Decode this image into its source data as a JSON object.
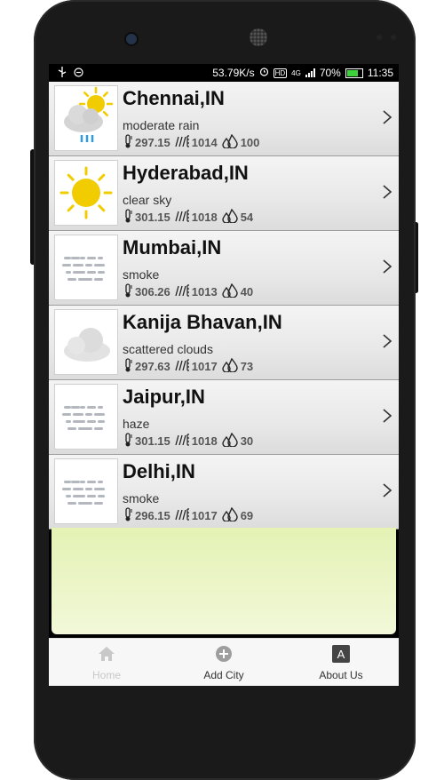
{
  "status_bar": {
    "net_speed": "53.79K/s",
    "network_type": "4G",
    "battery": "70%",
    "time": "11:35"
  },
  "cities": [
    {
      "name": "Chennai,IN",
      "desc": "moderate rain",
      "temp": "297.15",
      "pressure": "1014",
      "humidity": "100",
      "icon": "rain-cloud-icon"
    },
    {
      "name": "Hyderabad,IN",
      "desc": "clear sky",
      "temp": "301.15",
      "pressure": "1018",
      "humidity": "54",
      "icon": "sun-icon"
    },
    {
      "name": "Mumbai,IN",
      "desc": "smoke",
      "temp": "306.26",
      "pressure": "1013",
      "humidity": "40",
      "icon": "haze-icon"
    },
    {
      "name": "Kanija Bhavan,IN",
      "desc": "scattered clouds",
      "temp": "297.63",
      "pressure": "1017",
      "humidity": "73",
      "icon": "cloud-icon"
    },
    {
      "name": "Jaipur,IN",
      "desc": "haze",
      "temp": "301.15",
      "pressure": "1018",
      "humidity": "30",
      "icon": "haze-icon"
    },
    {
      "name": "Delhi,IN",
      "desc": "smoke",
      "temp": "296.15",
      "pressure": "1017",
      "humidity": "69",
      "icon": "haze-icon"
    }
  ],
  "tabs": [
    {
      "label": "Home",
      "icon": "home-icon",
      "active": false
    },
    {
      "label": "Add City",
      "icon": "add-circle-icon",
      "active": true
    },
    {
      "label": "About Us",
      "icon": "about-a-icon",
      "active": true
    }
  ],
  "colors": {
    "sun": "#f1cc00",
    "rain": "#2f9be0",
    "tab_inactive": "#c8c8c8",
    "tab_active": "#333333"
  }
}
